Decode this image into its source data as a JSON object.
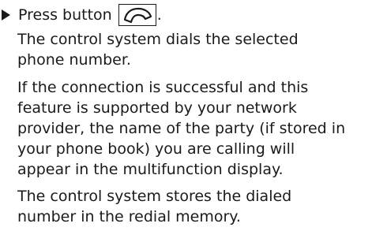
{
  "instruction": {
    "prefix": "Press button",
    "suffix": ".",
    "button_icon": "phone-handset-icon"
  },
  "paragraphs": [
    {
      "lines": [
        "The control system dials the selected",
        "phone number."
      ]
    },
    {
      "lines": [
        "If the connection is successful and this",
        "feature is supported by your network",
        "provider, the name of the party (if stored in",
        "your phone book) you are calling will",
        "appear in the multifunction display."
      ]
    },
    {
      "lines": [
        "The control system stores the dialed",
        "number in the redial memory."
      ]
    }
  ]
}
